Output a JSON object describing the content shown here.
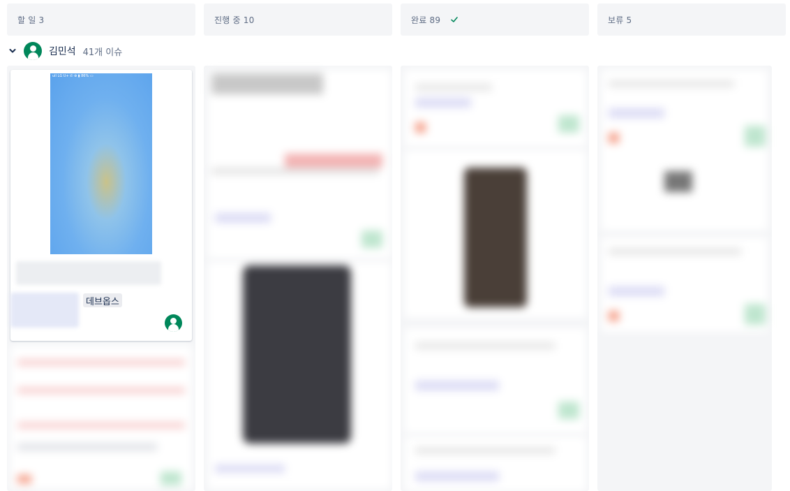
{
  "columns": [
    {
      "title": "할 일 3"
    },
    {
      "title": "진행 중 10"
    },
    {
      "title": "완료 89",
      "icon": "check-icon"
    },
    {
      "title": "보류 5"
    }
  ],
  "swimlane": {
    "name": "김민석",
    "count": "41개 이슈",
    "icon": "chevron-down-icon"
  },
  "card": {
    "label": "데브옵스",
    "phone_status": "ull LG U+ ✆   ⊕ ▮ 86% ▭"
  },
  "colors": {
    "header_bg": "#f4f5f7",
    "avatar": "#00875a",
    "check": "#00875a"
  }
}
